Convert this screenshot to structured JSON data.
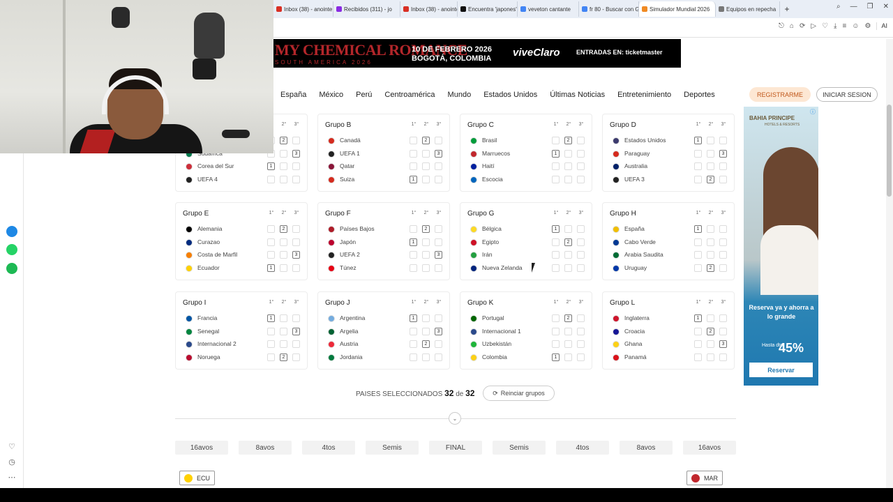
{
  "browser": {
    "tabs": [
      {
        "label": "Inbox (38) - anointe",
        "color": "#d93025",
        "active": false
      },
      {
        "label": "Recibidos (311) - jo",
        "color": "#8a2be2",
        "active": false
      },
      {
        "label": "Inbox (38) - anointe",
        "color": "#d93025",
        "active": false
      },
      {
        "label": "Encuentra 'japones'",
        "color": "#111111",
        "active": false
      },
      {
        "label": "veveton cantante",
        "color": "#4285f4",
        "active": false
      },
      {
        "label": "fr 80 - Buscar con G",
        "color": "#4285f4",
        "active": false
      },
      {
        "label": "Simulador Mundial 2026",
        "color": "#f08a24",
        "active": true
      },
      {
        "label": "Equipos en repecha",
        "color": "#777777",
        "active": false
      }
    ],
    "new_tab": "+",
    "window_controls": [
      "⌕",
      "—",
      "❐",
      "✕"
    ],
    "toolbar_icons": [
      "⎋",
      "⌂",
      "⟳",
      "▷",
      "♡",
      "⤓",
      "≡",
      "☺",
      "⚙"
    ],
    "ai_label": "AI"
  },
  "banner": {
    "band": "MY CHEMICAL ROMANCE",
    "tour": "SOUTH AMERICA 2026",
    "date_line1": "10 DE FEBRERO 2026",
    "date_line2": "BOGOTÁ, COLOMBIA",
    "sponsor": "viveClaro",
    "tickets": "ENTRADAS EN: ticketmaster"
  },
  "nav": {
    "items": [
      "España",
      "México",
      "Perú",
      "Centroamérica",
      "Mundo",
      "Estados Unidos",
      "Últimas Noticias",
      "Entretenimiento",
      "Deportes"
    ],
    "register": "REGISTRARME",
    "login": "INICIAR SESION"
  },
  "col_headers": [
    "1°",
    "2°",
    "3°"
  ],
  "groups": [
    {
      "name": "",
      "teams": [
        {
          "name": "",
          "color": "#ffffff",
          "pos": 2
        },
        {
          "name": "Sudáfrica",
          "color": "#007a4d",
          "pos": 3
        },
        {
          "name": "Corea del Sur",
          "color": "#cd2e3a",
          "pos": 1
        },
        {
          "name": "UEFA 4",
          "color": "#222222",
          "pos": 0
        }
      ]
    },
    {
      "name": "Grupo B",
      "teams": [
        {
          "name": "Canadá",
          "color": "#d52b1e",
          "pos": 2
        },
        {
          "name": "UEFA 1",
          "color": "#222222",
          "pos": 3
        },
        {
          "name": "Qatar",
          "color": "#8a1538",
          "pos": 0
        },
        {
          "name": "Suiza",
          "color": "#d52b1e",
          "pos": 1
        }
      ]
    },
    {
      "name": "Grupo C",
      "teams": [
        {
          "name": "Brasil",
          "color": "#009c3b",
          "pos": 2
        },
        {
          "name": "Marruecos",
          "color": "#c1272d",
          "pos": 1
        },
        {
          "name": "Haití",
          "color": "#00209f",
          "pos": 0
        },
        {
          "name": "Escocia",
          "color": "#0065bd",
          "pos": 0
        }
      ]
    },
    {
      "name": "Grupo D",
      "teams": [
        {
          "name": "Estados Unidos",
          "color": "#3c3b6e",
          "pos": 1
        },
        {
          "name": "Paraguay",
          "color": "#d52b1e",
          "pos": 3
        },
        {
          "name": "Australia",
          "color": "#012169",
          "pos": 0
        },
        {
          "name": "UEFA 3",
          "color": "#222222",
          "pos": 2
        }
      ]
    },
    {
      "name": "Grupo E",
      "teams": [
        {
          "name": "Alemania",
          "color": "#000000",
          "pos": 2
        },
        {
          "name": "Curazao",
          "color": "#002b7f",
          "pos": 0
        },
        {
          "name": "Costa de Marfil",
          "color": "#f77f00",
          "pos": 3
        },
        {
          "name": "Ecuador",
          "color": "#ffd100",
          "pos": 1
        }
      ]
    },
    {
      "name": "Grupo F",
      "teams": [
        {
          "name": "Países Bajos",
          "color": "#ae1c28",
          "pos": 2
        },
        {
          "name": "Japón",
          "color": "#bc002d",
          "pos": 1
        },
        {
          "name": "UEFA 2",
          "color": "#222222",
          "pos": 3
        },
        {
          "name": "Túnez",
          "color": "#e70013",
          "pos": 0
        }
      ]
    },
    {
      "name": "Grupo G",
      "teams": [
        {
          "name": "Bélgica",
          "color": "#fdda24",
          "pos": 1
        },
        {
          "name": "Egipto",
          "color": "#ce1126",
          "pos": 2
        },
        {
          "name": "Irán",
          "color": "#239f40",
          "pos": 0
        },
        {
          "name": "Nueva Zelanda",
          "color": "#00247d",
          "pos": 0
        }
      ]
    },
    {
      "name": "Grupo H",
      "teams": [
        {
          "name": "España",
          "color": "#f1bf00",
          "pos": 1
        },
        {
          "name": "Cabo Verde",
          "color": "#003893",
          "pos": 0
        },
        {
          "name": "Arabia Saudita",
          "color": "#006c35",
          "pos": 0
        },
        {
          "name": "Uruguay",
          "color": "#0038a8",
          "pos": 2
        }
      ]
    },
    {
      "name": "Grupo I",
      "teams": [
        {
          "name": "Francia",
          "color": "#0055a4",
          "pos": 1
        },
        {
          "name": "Senegal",
          "color": "#00853f",
          "pos": 3
        },
        {
          "name": "Internacional 2",
          "color": "#2b4a8b",
          "pos": 0
        },
        {
          "name": "Noruega",
          "color": "#ba0c2f",
          "pos": 2
        }
      ]
    },
    {
      "name": "Grupo J",
      "teams": [
        {
          "name": "Argentina",
          "color": "#74acdf",
          "pos": 1
        },
        {
          "name": "Argelia",
          "color": "#006233",
          "pos": 3
        },
        {
          "name": "Austria",
          "color": "#ed2939",
          "pos": 2
        },
        {
          "name": "Jordania",
          "color": "#007a3d",
          "pos": 0
        }
      ]
    },
    {
      "name": "Grupo K",
      "teams": [
        {
          "name": "Portugal",
          "color": "#006600",
          "pos": 2
        },
        {
          "name": "Internacional 1",
          "color": "#2b4a8b",
          "pos": 0
        },
        {
          "name": "Uzbekistán",
          "color": "#1eb53a",
          "pos": 0
        },
        {
          "name": "Colombia",
          "color": "#fcd116",
          "pos": 1
        }
      ]
    },
    {
      "name": "Grupo L",
      "teams": [
        {
          "name": "Inglaterra",
          "color": "#cf142b",
          "pos": 1
        },
        {
          "name": "Croacia",
          "color": "#171796",
          "pos": 2
        },
        {
          "name": "Ghana",
          "color": "#fcd116",
          "pos": 3
        },
        {
          "name": "Panamá",
          "color": "#da121a",
          "pos": 0
        }
      ]
    }
  ],
  "selection": {
    "label": "PAISES SELECCIONADOS",
    "count": "32",
    "of": "de",
    "total": "32",
    "reset": "Reinciar grupos",
    "reset_icon": "⟳"
  },
  "chevron": "⌄",
  "rounds": [
    "16avos",
    "8avos",
    "4tos",
    "Semis",
    "FINAL",
    "Semis",
    "4tos",
    "8avos",
    "16avos"
  ],
  "bracket": {
    "left_team": {
      "code": "ECU",
      "color": "#ffd100"
    },
    "right_team": {
      "code": "MAR",
      "color": "#c1272d"
    }
  },
  "ad": {
    "brand": "BAHIA PRINCIPE",
    "brand_sub": "HOTELS & RESORTS",
    "slogan": "Reserva ya y ahorra a lo grande",
    "discount_label": "Hasta dto.",
    "discount_value": "45%",
    "cta": "Reservar"
  }
}
